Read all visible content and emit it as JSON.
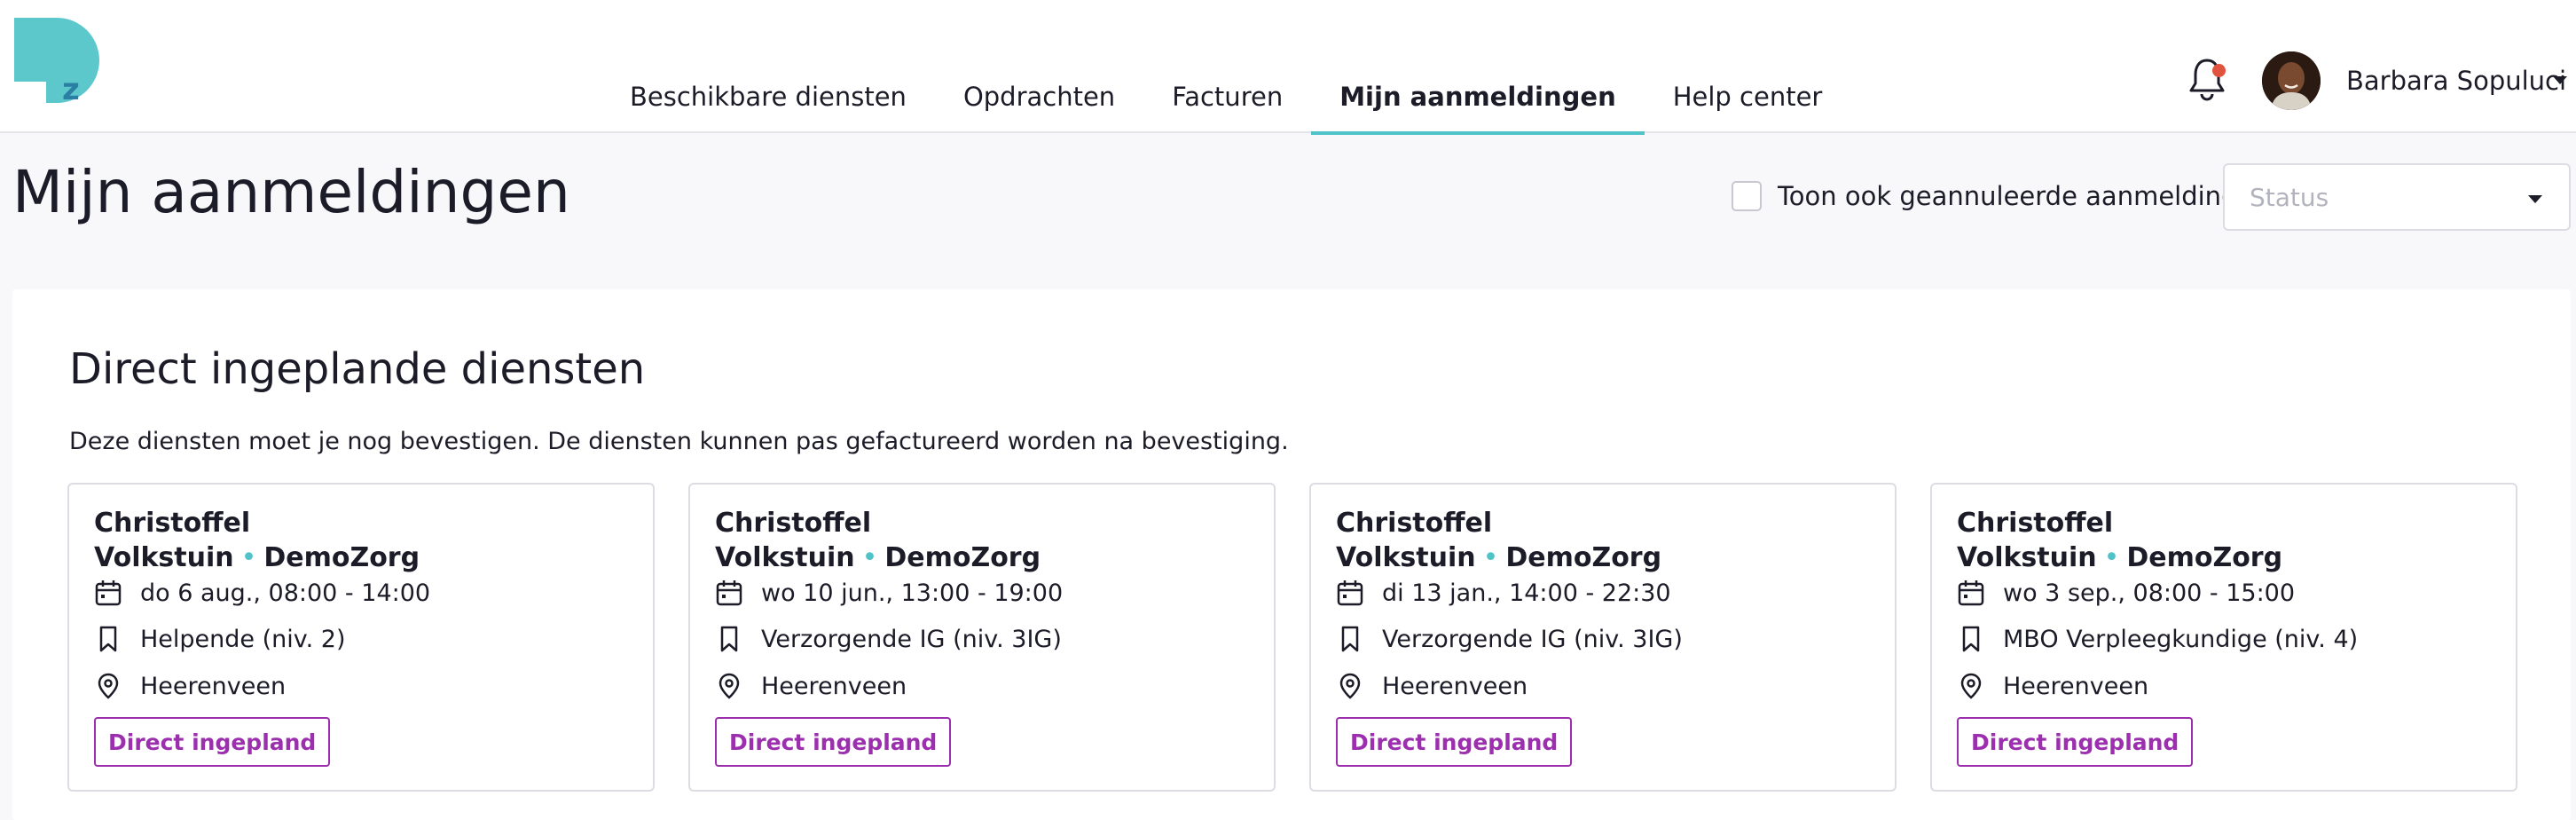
{
  "header": {
    "logo_icon": "demozorg-logo",
    "nav": [
      {
        "label": "Beschikbare diensten"
      },
      {
        "label": "Opdrachten"
      },
      {
        "label": "Facturen"
      },
      {
        "label": "Mijn aanmeldingen",
        "active": true
      },
      {
        "label": "Help center"
      }
    ],
    "notification_icon": "bell-icon",
    "user": {
      "name": "Barbara Sopuluci"
    }
  },
  "page": {
    "title": "Mijn aanmeldingen",
    "filter_checkbox_label": "Toon ook geannuleerde aanmeldingen",
    "filter_checked": false,
    "status_select": {
      "placeholder": "Status"
    }
  },
  "section": {
    "title": "Direct ingeplande diensten",
    "description": "Deze diensten moet je nog bevestigen. De diensten kunnen pas gefactureerd worden na bevestiging.",
    "cards": [
      {
        "line1": "Christoffel",
        "line2": "Volkstuin",
        "separator": "•",
        "org": "DemoZorg",
        "datetime": "do 6 aug., 08:00 - 14:00",
        "role": "Helpende (niv. 2)",
        "location": "Heerenveen",
        "badge": "Direct ingepland"
      },
      {
        "line1": "Christoffel",
        "line2": "Volkstuin",
        "separator": "•",
        "org": "DemoZorg",
        "datetime": "wo 10 jun., 13:00 - 19:00",
        "role": "Verzorgende IG (niv. 3IG)",
        "location": "Heerenveen",
        "badge": "Direct ingepland"
      },
      {
        "line1": "Christoffel",
        "line2": "Volkstuin",
        "separator": "•",
        "org": "DemoZorg",
        "datetime": "di 13 jan., 14:00 - 22:30",
        "role": "Verzorgende IG (niv. 3IG)",
        "location": "Heerenveen",
        "badge": "Direct ingepland"
      },
      {
        "line1": "Christoffel",
        "line2": "Volkstuin",
        "separator": "•",
        "org": "DemoZorg",
        "datetime": "wo 3 sep., 08:00 - 15:00",
        "role": "MBO Verpleegkundige (niv. 4)",
        "location": "Heerenveen",
        "badge": "Direct ingepland"
      }
    ]
  },
  "colors": {
    "accent": "#4fc3c7",
    "badge": "#9b2fae",
    "notification_dot": "#e0533f"
  }
}
